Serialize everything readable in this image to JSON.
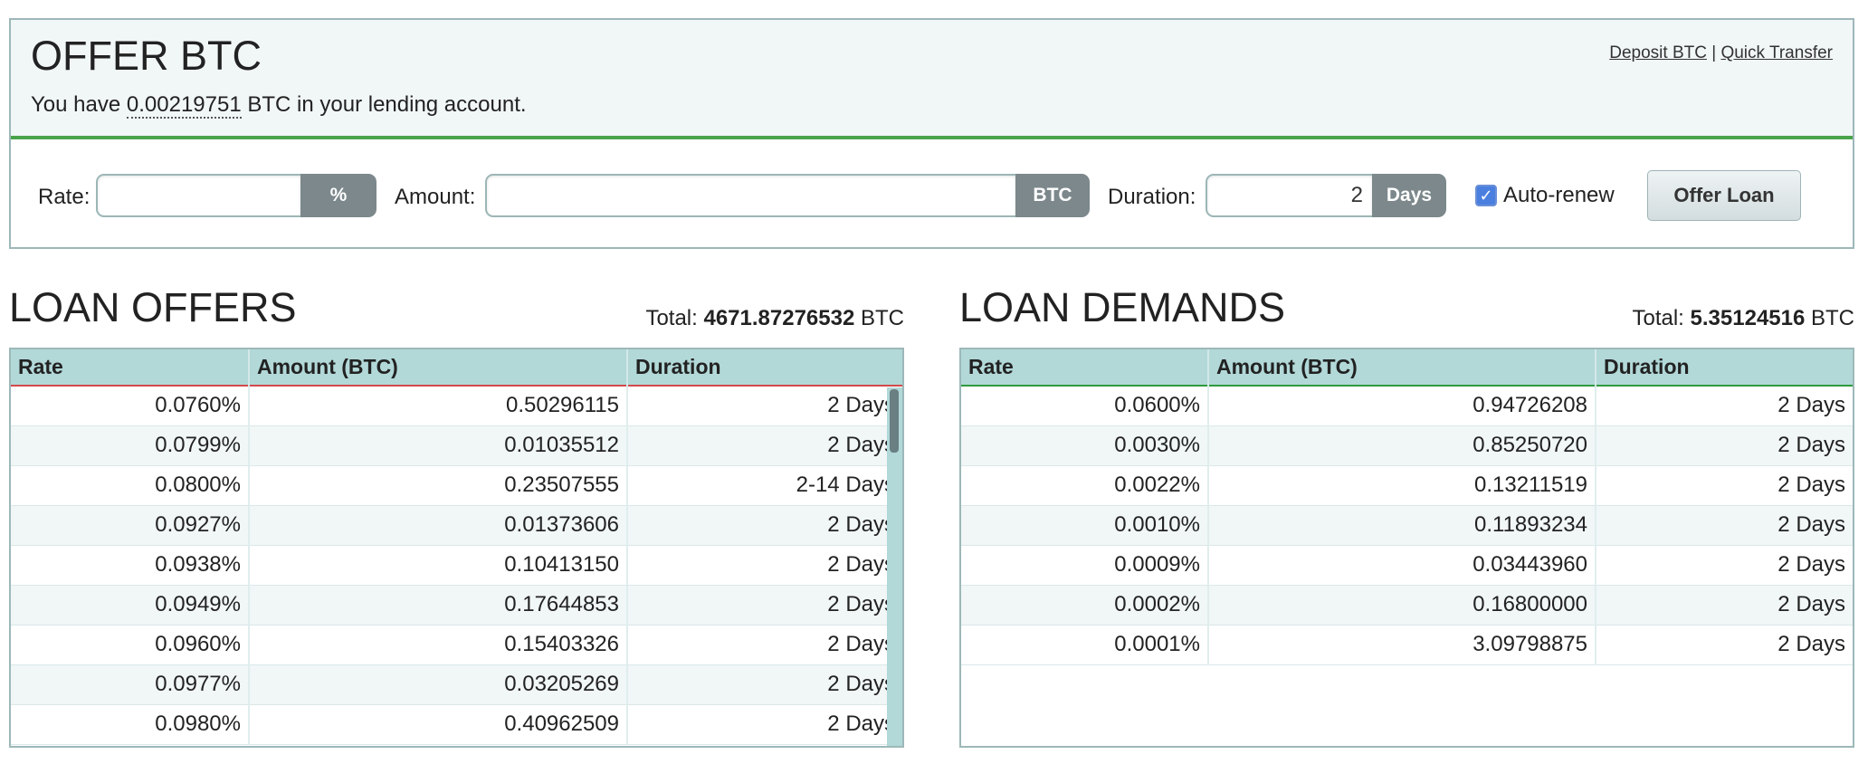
{
  "offer_panel": {
    "title": "OFFER BTC",
    "sub_prefix": "You have",
    "balance": "0.00219751",
    "sub_suffix": "BTC in your lending account.",
    "links": {
      "deposit": "Deposit BTC",
      "separator": "|",
      "quick_transfer": "Quick Transfer"
    },
    "form": {
      "rate_label": "Rate:",
      "rate_value": "",
      "rate_unit": "%",
      "amount_label": "Amount:",
      "amount_value": "",
      "amount_unit": "BTC",
      "duration_label": "Duration:",
      "duration_value": "2",
      "duration_unit": "Days",
      "autorenew_label": "Auto-renew",
      "autorenew_checked": true,
      "submit_label": "Offer Loan"
    }
  },
  "loan_offers": {
    "title": "LOAN OFFERS",
    "total_label": "Total:",
    "total_value": "4671.87276532",
    "total_unit": "BTC",
    "columns": [
      "Rate",
      "Amount (BTC)",
      "Duration"
    ],
    "rows": [
      [
        "0.0760%",
        "0.50296115",
        "2 Days"
      ],
      [
        "0.0799%",
        "0.01035512",
        "2 Days"
      ],
      [
        "0.0800%",
        "0.23507555",
        "2-14 Days"
      ],
      [
        "0.0927%",
        "0.01373606",
        "2 Days"
      ],
      [
        "0.0938%",
        "0.10413150",
        "2 Days"
      ],
      [
        "0.0949%",
        "0.17644853",
        "2 Days"
      ],
      [
        "0.0960%",
        "0.15403326",
        "2 Days"
      ],
      [
        "0.0977%",
        "0.03205269",
        "2 Days"
      ],
      [
        "0.0980%",
        "0.40962509",
        "2 Days"
      ]
    ]
  },
  "loan_demands": {
    "title": "LOAN DEMANDS",
    "total_label": "Total:",
    "total_value": "5.35124516",
    "total_unit": "BTC",
    "columns": [
      "Rate",
      "Amount (BTC)",
      "Duration"
    ],
    "rows": [
      [
        "0.0600%",
        "0.94726208",
        "2 Days"
      ],
      [
        "0.0030%",
        "0.85250720",
        "2 Days"
      ],
      [
        "0.0022%",
        "0.13211519",
        "2 Days"
      ],
      [
        "0.0010%",
        "0.11893234",
        "2 Days"
      ],
      [
        "0.0009%",
        "0.03443960",
        "2 Days"
      ],
      [
        "0.0002%",
        "0.16800000",
        "2 Days"
      ],
      [
        "0.0001%",
        "3.09798875",
        "2 Days"
      ]
    ]
  },
  "colors": {
    "panel_border": "#9eb7b9",
    "header_teal": "#b2d8d8",
    "offers_accent": "#d34a4a",
    "demands_accent": "#2f9a3d",
    "form_divider": "#4aa34a",
    "addon_gray": "#7c888b"
  }
}
